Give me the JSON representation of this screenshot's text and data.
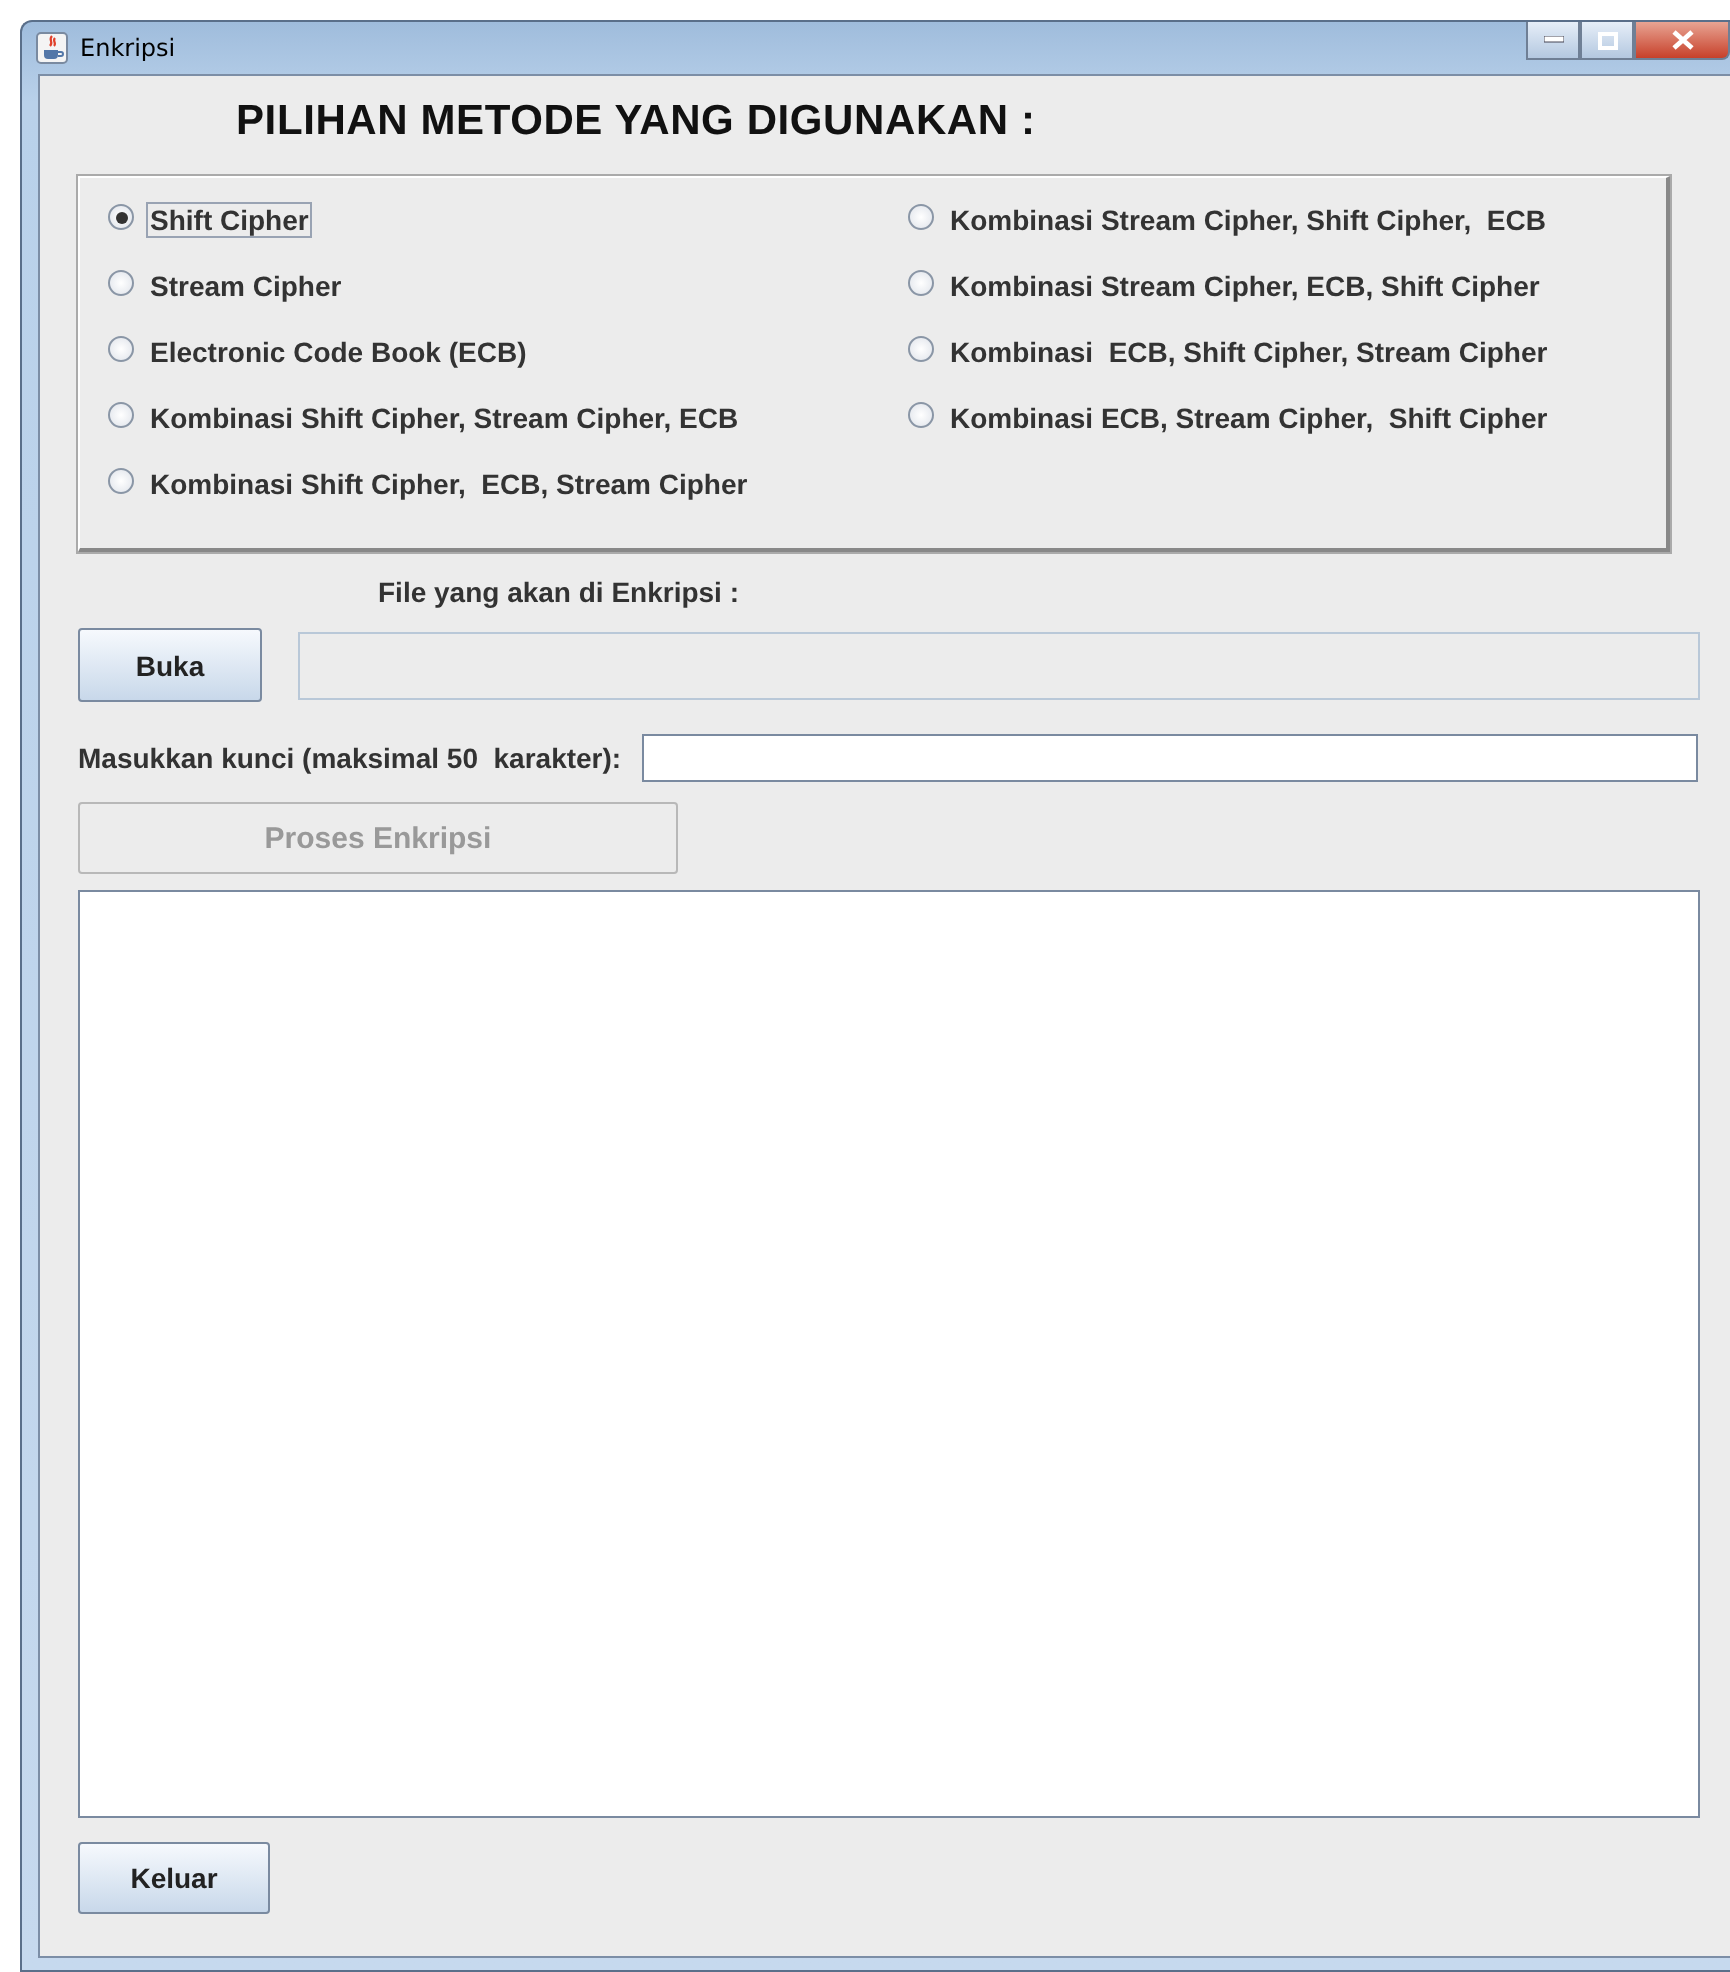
{
  "window": {
    "title": "Enkripsi"
  },
  "heading": "PILIHAN METODE YANG DIGUNAKAN :",
  "options": [
    {
      "label": "Shift Cipher",
      "selected": true,
      "focused": true
    },
    {
      "label": "Stream Cipher",
      "selected": false,
      "focused": false
    },
    {
      "label": "Electronic Code Book (ECB)",
      "selected": false,
      "focused": false
    },
    {
      "label": "Kombinasi Shift Cipher, Stream Cipher, ECB",
      "selected": false,
      "focused": false
    },
    {
      "label": "Kombinasi Shift Cipher,  ECB, Stream Cipher",
      "selected": false,
      "focused": false
    },
    {
      "label": "Kombinasi Stream Cipher, Shift Cipher,  ECB",
      "selected": false,
      "focused": false
    },
    {
      "label": "Kombinasi Stream Cipher, ECB, Shift Cipher",
      "selected": false,
      "focused": false
    },
    {
      "label": "Kombinasi  ECB, Shift Cipher, Stream Cipher",
      "selected": false,
      "focused": false
    },
    {
      "label": "Kombinasi ECB, Stream Cipher,  Shift Cipher",
      "selected": false,
      "focused": false
    }
  ],
  "file_label": "File yang akan di Enkripsi :",
  "open_button": {
    "label": "Buka"
  },
  "file_field": {
    "disabled": true
  },
  "key_label": "Masukkan kunci (maksimal 50  karakter):",
  "process_button": {
    "label": "Proses Enkripsi",
    "disabled": true
  },
  "exit_button": {
    "label": "Keluar"
  }
}
